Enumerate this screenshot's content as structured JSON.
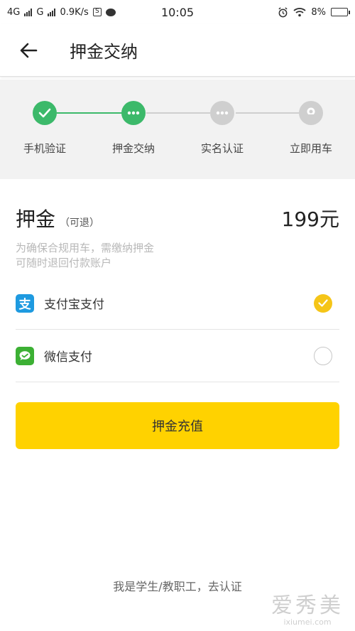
{
  "status_bar": {
    "network_1": "4G",
    "network_2": "G",
    "speed": "0.9K/s",
    "s_box": "S",
    "time": "10:05",
    "battery": "8%"
  },
  "app_bar": {
    "title": "押金交纳",
    "back_icon": "arrow-left"
  },
  "steps": [
    {
      "label": "手机验证",
      "state": "done",
      "icon": "check"
    },
    {
      "label": "押金交纳",
      "state": "current",
      "icon": "more-dots"
    },
    {
      "label": "实名认证",
      "state": "pending",
      "icon": "more-dots"
    },
    {
      "label": "立即用车",
      "state": "pending",
      "icon": "map-pin"
    }
  ],
  "deposit": {
    "title": "押金",
    "refundable": "（可退）",
    "amount": "199元",
    "note_line1": "为确保合规用车，需缴纳押金",
    "note_line2": "可随时退回付款账户"
  },
  "payment_methods": [
    {
      "name": "支付宝支付",
      "selected": true,
      "logo": "支",
      "color": "#1e9ae0"
    },
    {
      "name": "微信支付",
      "selected": false,
      "logo": "wechat",
      "color": "#3cb034"
    }
  ],
  "cta_label": "押金充值",
  "footer_link": "我是学生/教职工，去认证",
  "watermark": {
    "main": "爱秀美",
    "sub": "ixiumei.com"
  },
  "colors": {
    "green": "#3cb96a",
    "gray_step": "#cfcfcf",
    "yellow": "#ffd200",
    "check_yellow": "#f5c518"
  }
}
